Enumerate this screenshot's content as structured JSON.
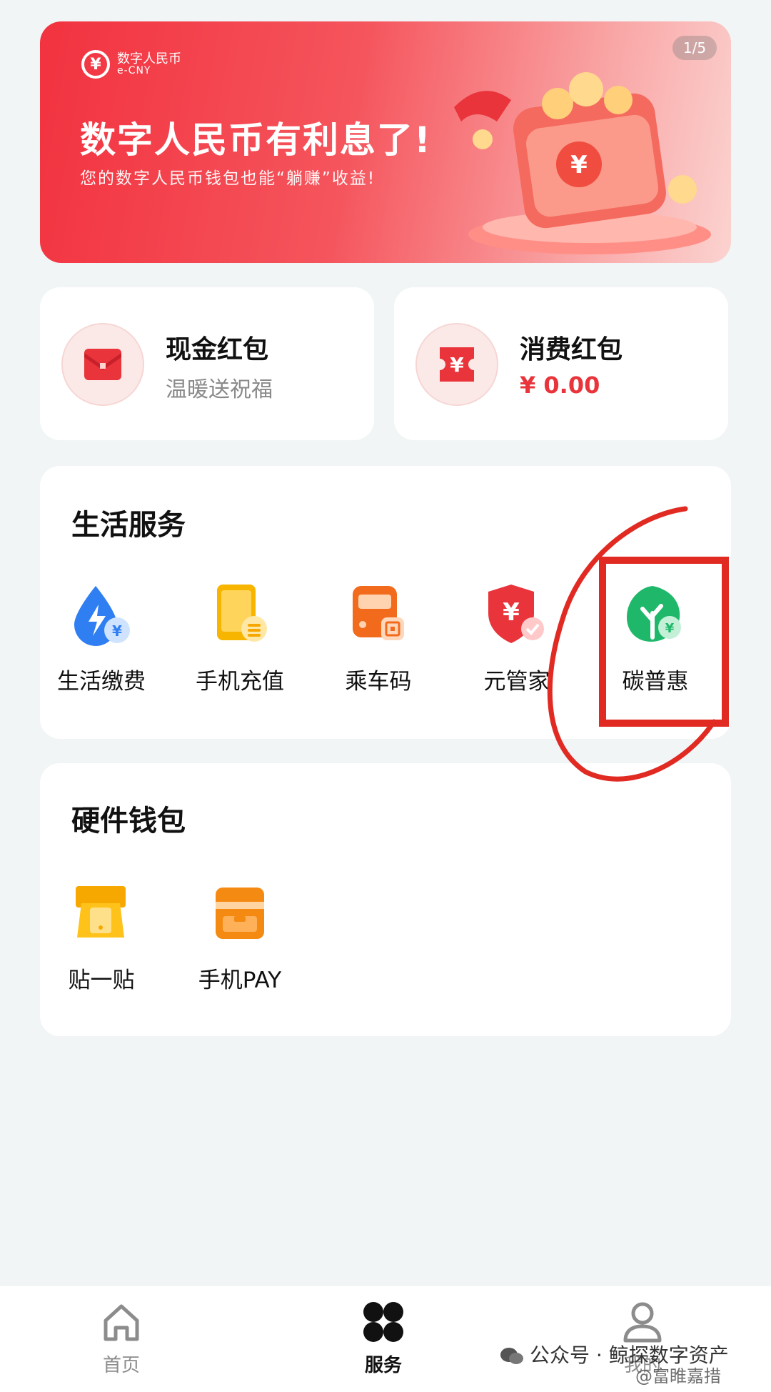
{
  "banner": {
    "logo_cn": "数字人民币",
    "logo_en": "e-CNY",
    "page_indicator": "1/5",
    "title": "数字人民币有利息了!",
    "subtitle": "您的数字人民币钱包也能“躺赚”收益!"
  },
  "red_packets": [
    {
      "title": "现金红包",
      "subtitle": "温暖送祝福",
      "icon": "red-envelope-icon"
    },
    {
      "title": "消费红包",
      "amount": "¥ 0.00",
      "icon": "yuan-coupon-icon"
    }
  ],
  "life_services": {
    "title": "生活服务",
    "items": [
      {
        "label": "生活缴费",
        "icon": "water-bolt-icon"
      },
      {
        "label": "手机充值",
        "icon": "phone-topup-icon"
      },
      {
        "label": "乘车码",
        "icon": "bus-icon"
      },
      {
        "label": "元管家",
        "icon": "yuan-shield-icon"
      },
      {
        "label": "碳普惠",
        "icon": "leaf-icon"
      }
    ]
  },
  "hardware_wallet": {
    "title": "硬件钱包",
    "items": [
      {
        "label": "贴一贴",
        "icon": "tap-card-icon"
      },
      {
        "label": "手机PAY",
        "icon": "wallet-card-icon"
      }
    ]
  },
  "bottom_nav": {
    "items": [
      {
        "label": "首页",
        "icon": "home-icon",
        "active": false
      },
      {
        "label": "服务",
        "icon": "services-grid-icon",
        "active": true
      },
      {
        "label": "我的",
        "icon": "profile-icon",
        "active": false
      }
    ]
  },
  "watermark": {
    "line1": "公众号 · 鲸探数字资产",
    "line2": "@富睢嘉措"
  },
  "colors": {
    "accent_red": "#e8343a",
    "background": "#f1f5f6",
    "annotation_red": "#e02a22"
  }
}
